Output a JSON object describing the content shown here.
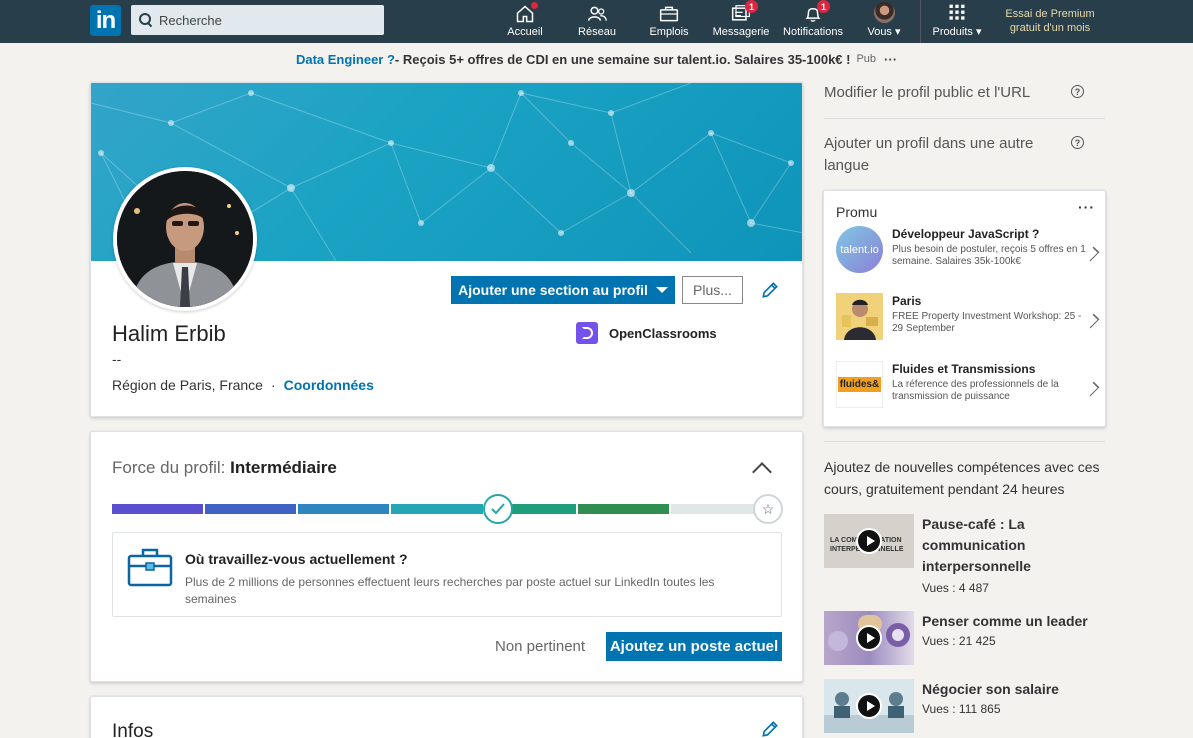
{
  "nav": {
    "logo_text": "in",
    "search_placeholder": "Recherche",
    "items": [
      {
        "label": "Accueil",
        "badge": ""
      },
      {
        "label": "Réseau",
        "badge": ""
      },
      {
        "label": "Emplois",
        "badge": ""
      },
      {
        "label": "Messagerie",
        "badge": "1"
      },
      {
        "label": "Notifications",
        "badge": "1"
      },
      {
        "label": "Vous ▾",
        "badge": ""
      },
      {
        "label": "Produits ▾",
        "badge": ""
      }
    ],
    "premium": "Essai de Premium gratuit d'un mois"
  },
  "ad": {
    "highlight": "Data Engineer ?",
    "text": " - Reçois 5+ offres de CDI en une semaine sur talent.io. Salaires 35-100k€ !",
    "pub": "Pub",
    "more": "···"
  },
  "profile": {
    "name": "Halim Erbib",
    "headline": "--",
    "location": "Région de Paris, France",
    "separator": "·",
    "contact_link": "Coordonnées",
    "add_section_button": "Ajouter une section au profil",
    "more_button": "Plus...",
    "company": "OpenClassrooms"
  },
  "strength": {
    "title_prefix": "Force du profil: ",
    "level": "Intermédiaire",
    "progress_steps_filled": 6,
    "progress_steps_total": 7,
    "question": "Où travaillez-vous actuellement ?",
    "description": "Plus de 2 millions de personnes effectuent leurs recherches par poste actuel sur LinkedIn toutes les semaines",
    "dismiss": "Non pertinent",
    "action": "Ajoutez un poste actuel"
  },
  "infos": {
    "title": "Infos"
  },
  "rail": {
    "edit_public": "Modifier le profil public et l'URL",
    "add_language": "Ajouter un profil dans une autre langue",
    "help_glyph": "?",
    "promu_title": "Promu",
    "promu_more": "···",
    "promos": [
      {
        "title": "Développeur JavaScript ?",
        "desc": "Plus besoin de postuler, reçois 5 offres en 1 semaine. Salaires 35k-100k€",
        "logo": "talent.io"
      },
      {
        "title": "Paris",
        "desc": "FREE Property Investment Workshop: 25 - 29 September",
        "logo": ""
      },
      {
        "title": "Fluides et Transmissions",
        "desc": "La réference des professionnels de la transmission de puissance",
        "logo": "fluides&"
      }
    ],
    "learning_head": "Ajoutez de nouvelles compétences avec ces cours, gratuitement pendant 24 heures",
    "courses": [
      {
        "title": "Pause-café : La communication interpersonnelle",
        "views": "Vues : 4 487",
        "thumb_text": "LA COMMUNICATION INTERPERSONNELLE"
      },
      {
        "title": "Penser comme un leader",
        "views": "Vues : 21 425",
        "thumb_text": ""
      },
      {
        "title": "Négocier son salaire",
        "views": "Vues : 111 865",
        "thumb_text": ""
      }
    ]
  },
  "colors": {
    "nav_bg": "#283e4a",
    "brand_blue": "#0073b1",
    "meter": [
      "#5a4fcf",
      "#3e63c4",
      "#2e86c1",
      "#25a7b3",
      "#1f9e7e",
      "#2f8f4e",
      "#e1e6e9"
    ]
  }
}
